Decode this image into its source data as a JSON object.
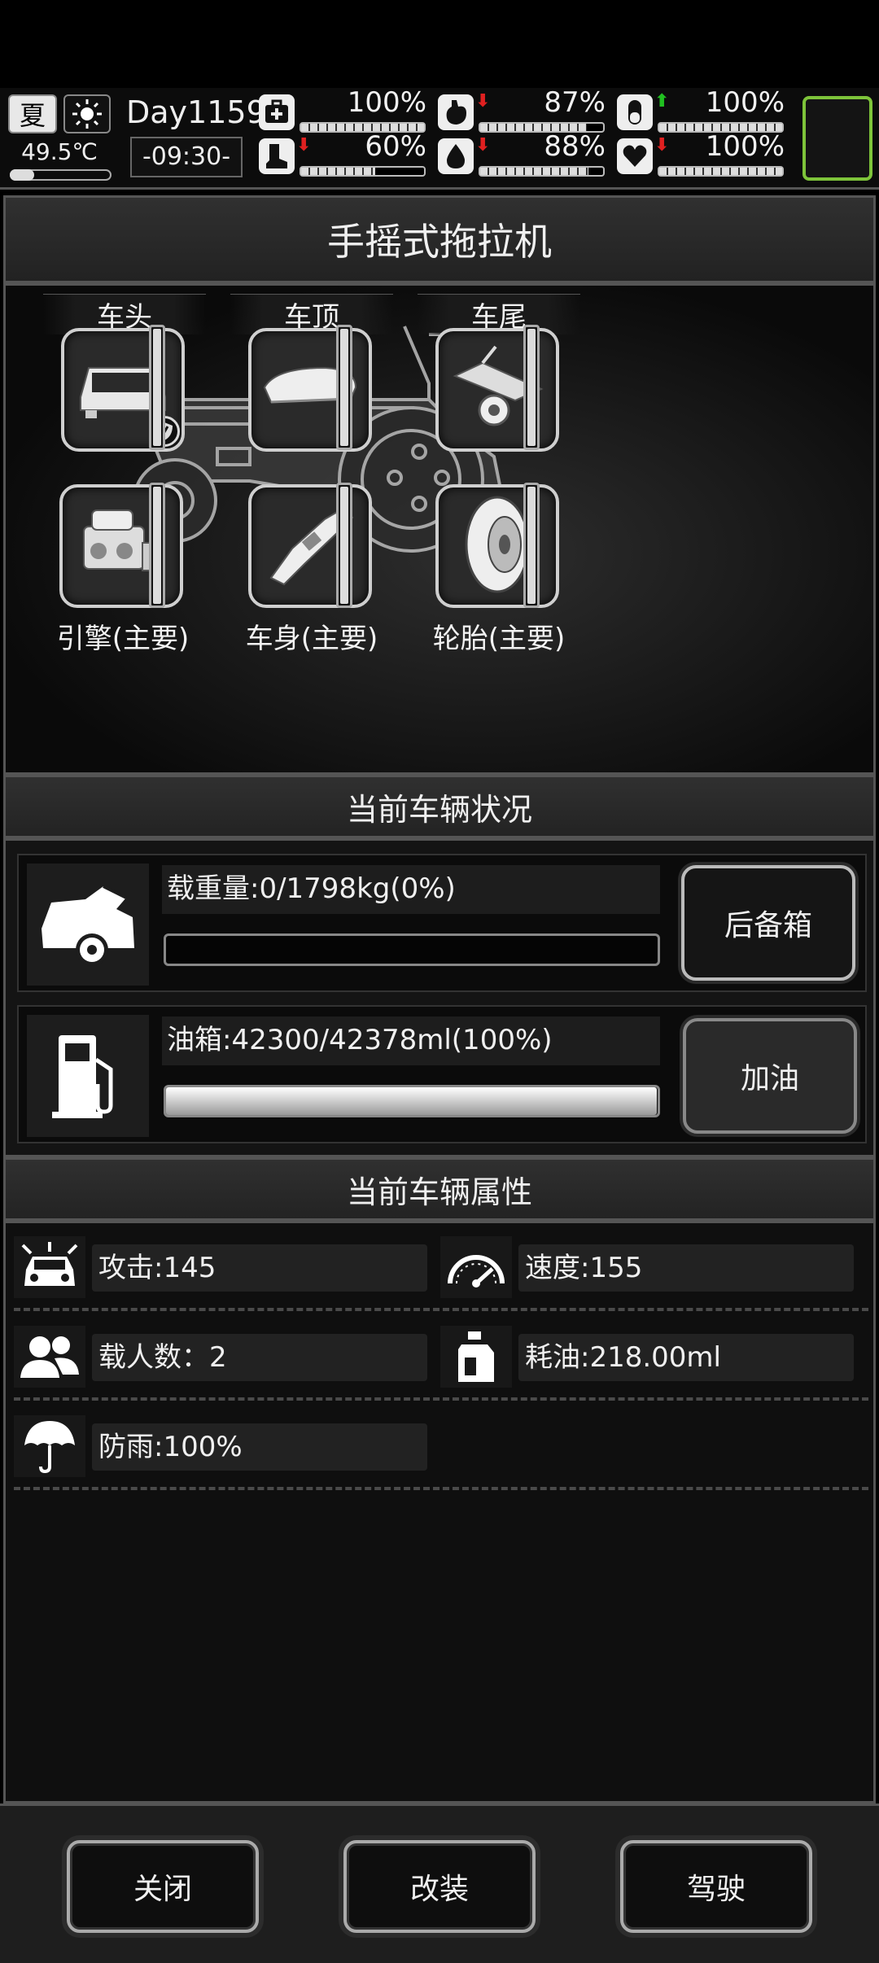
{
  "hud": {
    "season": "夏",
    "season_icon": "season-badge-icon",
    "weather_icon": "sun-icon",
    "temperature": "49.5℃",
    "day": "Day1159",
    "time": "-09:30-",
    "stats": [
      {
        "name": "health",
        "icon": "medkit-icon",
        "arrow": "",
        "pct_text": "100%",
        "value": 1.0
      },
      {
        "name": "hunger",
        "icon": "stomach-icon",
        "arrow": "down",
        "pct_text": "87%",
        "value": 0.87
      },
      {
        "name": "mood",
        "icon": "pill-icon",
        "arrow": "up",
        "pct_text": "100%",
        "value": 1.0
      },
      {
        "name": "stamina",
        "icon": "boot-icon",
        "arrow": "down",
        "pct_text": "60%",
        "value": 0.6
      },
      {
        "name": "thirst",
        "icon": "water-drop-icon",
        "arrow": "down",
        "pct_text": "88%",
        "value": 0.88
      },
      {
        "name": "heart",
        "icon": "heart-icon",
        "arrow": "down",
        "pct_text": "100%",
        "value": 1.0
      }
    ],
    "slot_border_color": "#7ec43a"
  },
  "vehicle": {
    "title": "手摇式拖拉机",
    "slots": [
      {
        "label": "车头",
        "icon": "car-front-icon",
        "badge": "shield-icon",
        "durability": 1.0
      },
      {
        "label": "车顶",
        "icon": "roof-box-icon",
        "durability": 1.0
      },
      {
        "label": "车尾",
        "icon": "trailer-icon",
        "durability": 1.0
      },
      {
        "label": "引擎(主要)",
        "icon": "engine-icon",
        "durability": 1.0
      },
      {
        "label": "车身(主要)",
        "icon": "chassis-icon",
        "durability": 1.0
      },
      {
        "label": "轮胎(主要)",
        "icon": "tire-icon",
        "durability": 1.0
      }
    ]
  },
  "status": {
    "title": "当前车辆状况",
    "load": {
      "icon": "car-trunk-icon",
      "text": "载重量:0/1798kg(0%)",
      "fraction": 0.0,
      "button": "后备箱"
    },
    "fuel": {
      "icon": "fuel-pump-icon",
      "text": "油箱:42300/42378ml(100%)",
      "fraction": 0.998,
      "button": "加油"
    }
  },
  "attributes": {
    "title": "当前车辆属性",
    "items": [
      {
        "icon": "car-attack-icon",
        "text": "攻击:145"
      },
      {
        "icon": "speedometer-icon",
        "text": "速度:155"
      },
      {
        "icon": "passengers-icon",
        "text": "载人数：2"
      },
      {
        "icon": "oil-can-icon",
        "text": "耗油:218.00ml"
      },
      {
        "icon": "umbrella-icon",
        "text": "防雨:100%"
      }
    ]
  },
  "footer": {
    "close": "关闭",
    "modify": "改装",
    "drive": "驾驶"
  }
}
